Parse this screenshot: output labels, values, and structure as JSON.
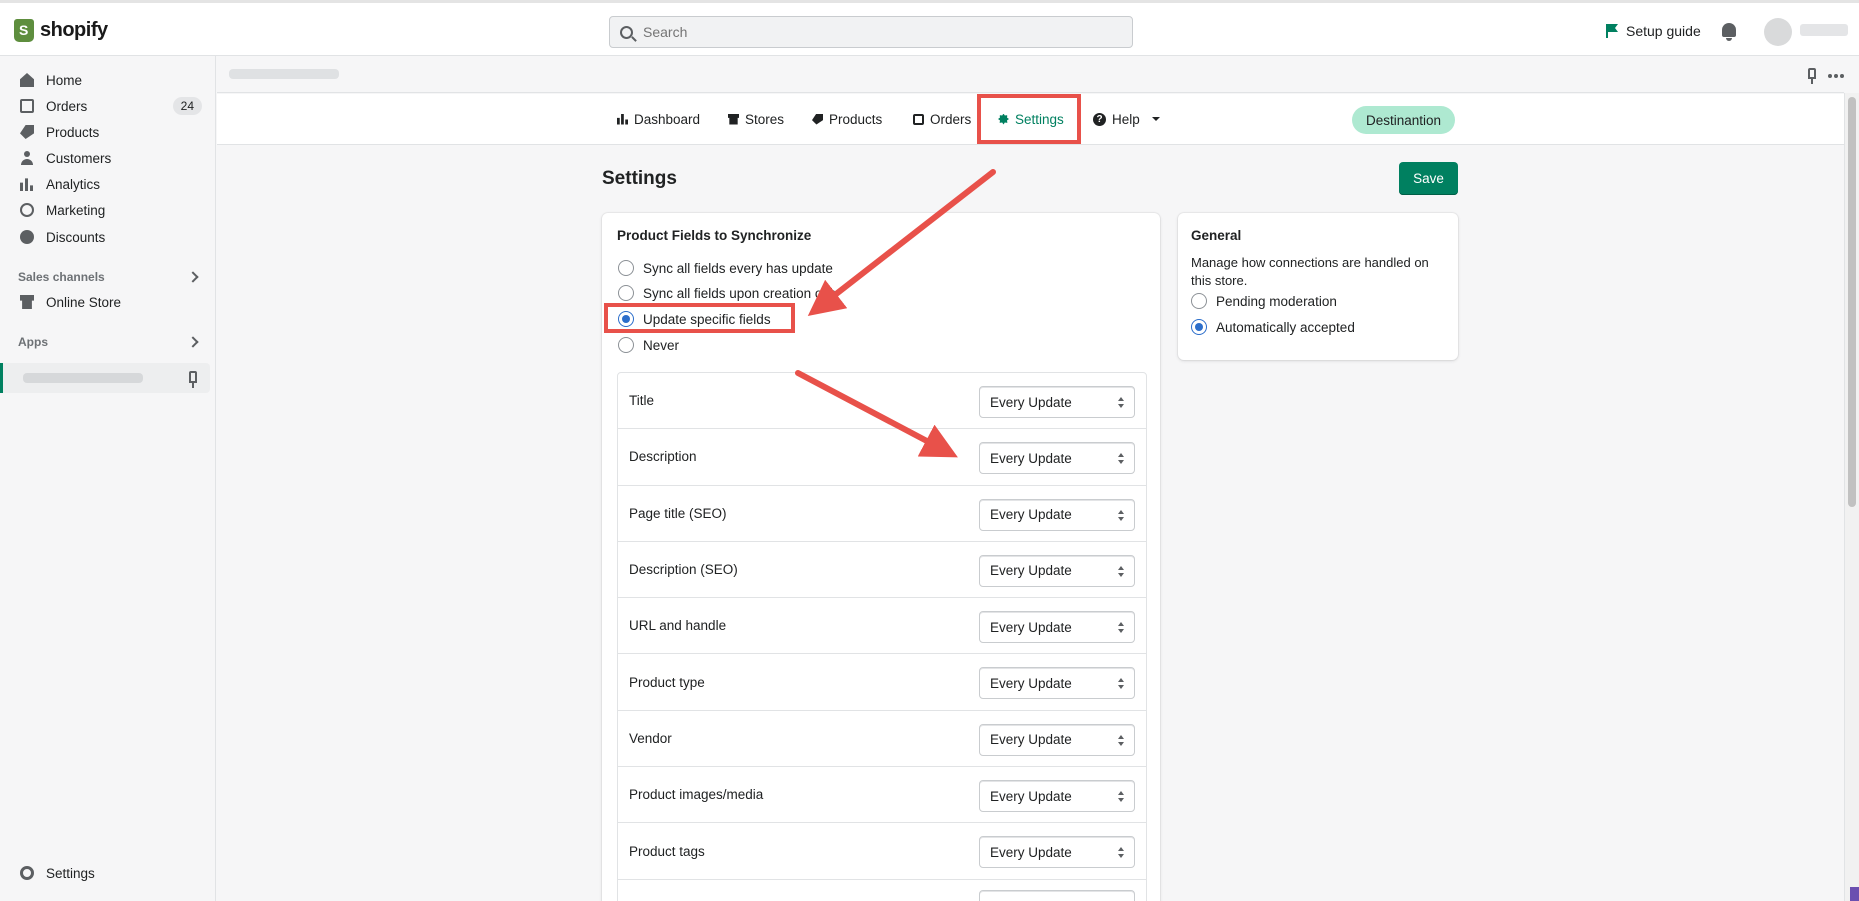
{
  "topbar": {
    "logo_text": "shopify",
    "search_placeholder": "Search",
    "setup_guide": "Setup guide"
  },
  "sidebar": {
    "items": [
      {
        "label": "Home",
        "icon": "home-icon"
      },
      {
        "label": "Orders",
        "icon": "orders-icon",
        "badge": "24"
      },
      {
        "label": "Products",
        "icon": "tag-icon"
      },
      {
        "label": "Customers",
        "icon": "person-icon"
      },
      {
        "label": "Analytics",
        "icon": "bar-chart-icon"
      },
      {
        "label": "Marketing",
        "icon": "target-icon"
      },
      {
        "label": "Discounts",
        "icon": "discount-icon"
      }
    ],
    "sales_channels_label": "Sales channels",
    "online_store": "Online Store",
    "apps_label": "Apps",
    "settings": "Settings"
  },
  "appnav": {
    "tabs": [
      {
        "label": "Dashboard",
        "icon": "chart-icon"
      },
      {
        "label": "Stores",
        "icon": "store-icon"
      },
      {
        "label": "Products",
        "icon": "tag-icon"
      },
      {
        "label": "Orders",
        "icon": "tray-icon"
      },
      {
        "label": "Settings",
        "icon": "gear-icon",
        "active": true
      },
      {
        "label": "Help",
        "icon": "question-icon"
      }
    ],
    "destination_badge": "Destinantion"
  },
  "page": {
    "title": "Settings",
    "save_label": "Save"
  },
  "product_fields": {
    "title": "Product Fields to Synchronize",
    "options": [
      {
        "label": "Sync all fields every has update",
        "checked": false
      },
      {
        "label": "Sync all fields upon creation only",
        "checked": false
      },
      {
        "label": "Update specific fields",
        "checked": true
      },
      {
        "label": "Never",
        "checked": false
      }
    ],
    "fields": [
      {
        "label": "Title",
        "value": "Every Update"
      },
      {
        "label": "Description",
        "value": "Every Update"
      },
      {
        "label": "Page title (SEO)",
        "value": "Every Update"
      },
      {
        "label": "Description (SEO)",
        "value": "Every Update"
      },
      {
        "label": "URL and handle",
        "value": "Every Update"
      },
      {
        "label": "Product type",
        "value": "Every Update"
      },
      {
        "label": "Vendor",
        "value": "Every Update"
      },
      {
        "label": "Product images/media",
        "value": "Every Update"
      },
      {
        "label": "Product tags",
        "value": "Every Update"
      }
    ]
  },
  "general": {
    "title": "General",
    "description": "Manage how connections are handled on this store.",
    "options": [
      {
        "label": "Pending moderation",
        "checked": false
      },
      {
        "label": "Automatically accepted",
        "checked": true
      }
    ]
  },
  "colors": {
    "accent": "#008060",
    "annotation": "#e8514a",
    "radio_checked": "#2c6ecb",
    "badge_bg": "#aee9d1"
  }
}
